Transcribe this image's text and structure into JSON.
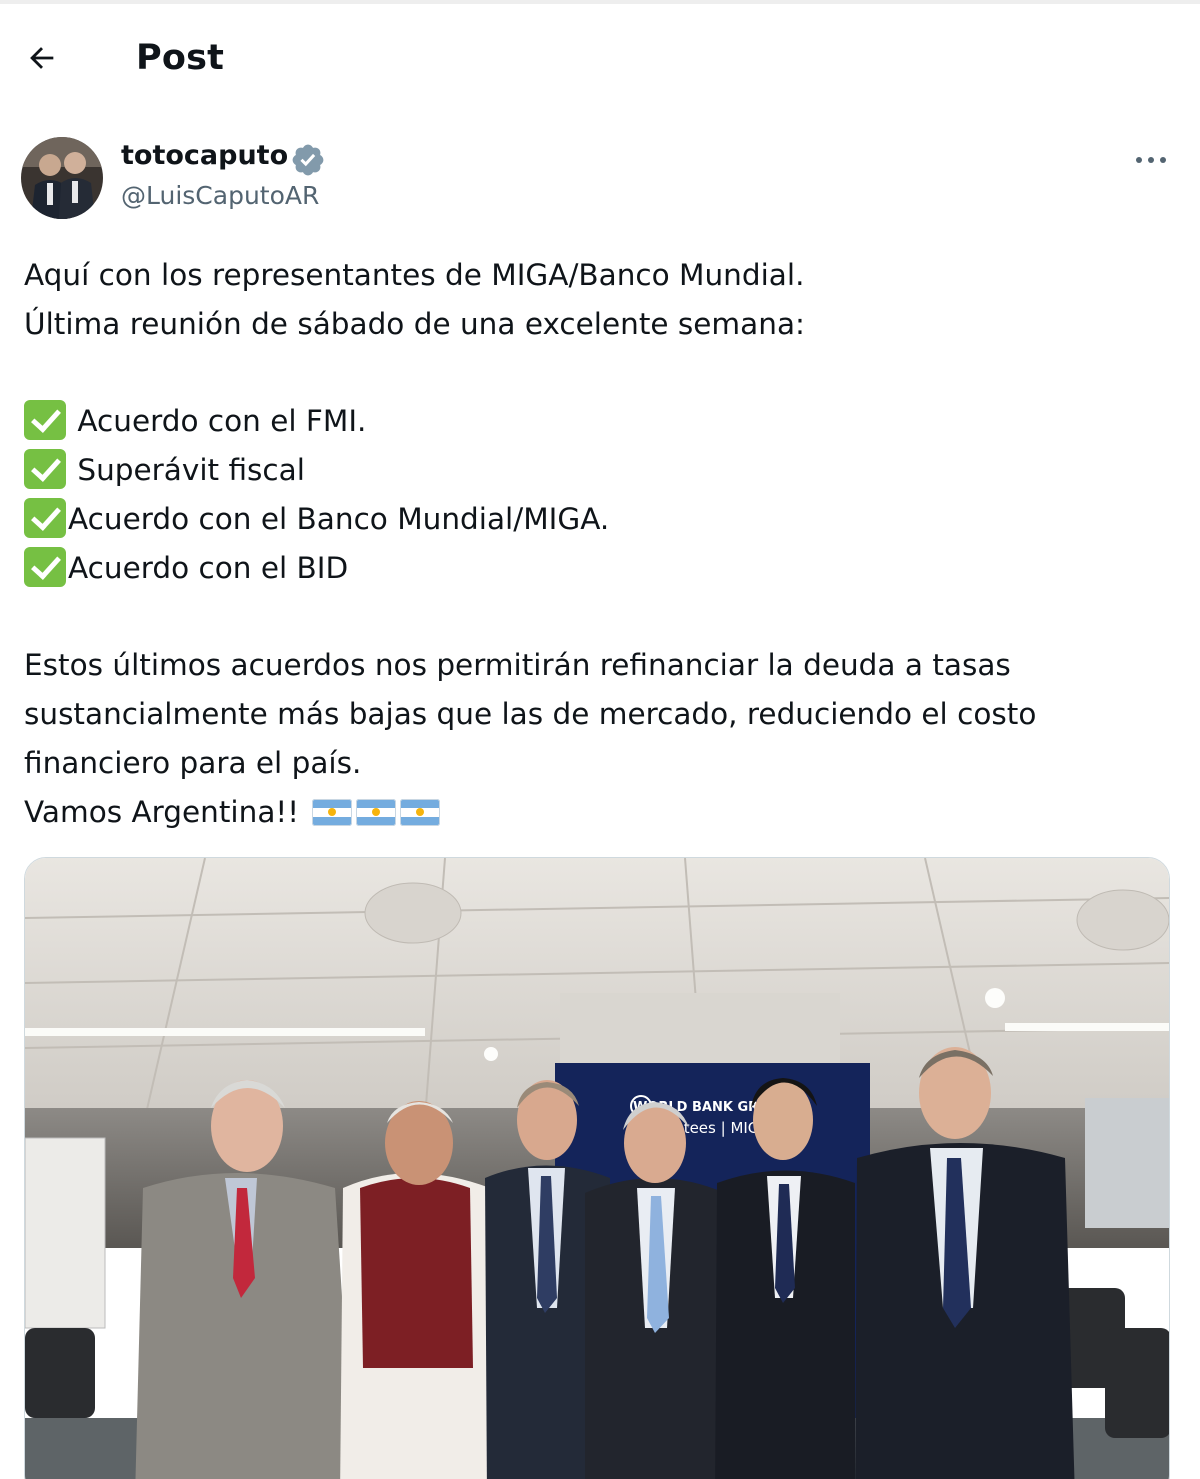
{
  "header": {
    "title": "Post"
  },
  "author": {
    "display_name": "totocaputo",
    "handle": "@LuisCaputoAR",
    "verified": true
  },
  "post": {
    "intro": [
      "Aquí con los representantes de MIGA/Banco Mundial.",
      "Última reunión de sábado de una excelente semana:"
    ],
    "checklist": [
      " Acuerdo con el FMI.",
      " Superávit fiscal",
      "Acuerdo con el Banco Mundial/MIGA.",
      "Acuerdo con el BID"
    ],
    "closing": [
      "Estos últimos acuerdos nos permitirán refinanciar la deuda a tasas",
      "sustancialmente más bajas que las de mercado, reduciendo el costo",
      "financiero para el país."
    ],
    "signoff": "Vamos Argentina!!",
    "emoji": {
      "check": "white-heavy-check-mark",
      "flag": "flag-argentina",
      "flag_count": 3
    }
  },
  "photo": {
    "banner_text": [
      "WORLD BANK GROUP",
      "antees | MIG"
    ]
  },
  "colors": {
    "text": "#0f1419",
    "secondary": "#536471",
    "verified": "#829aab",
    "check": "#76c043",
    "flag_blue": "#74acdf"
  }
}
